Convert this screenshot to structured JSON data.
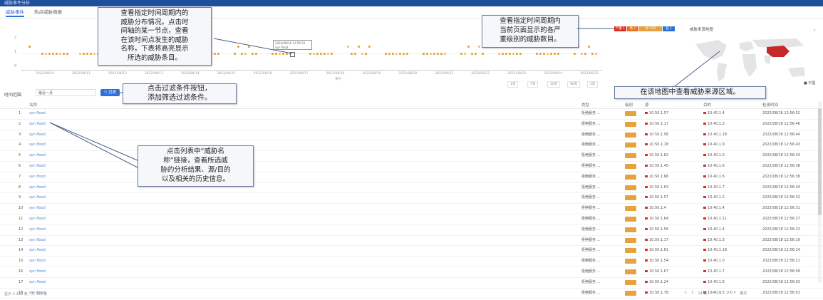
{
  "window": {
    "title": "威胁事件分析"
  },
  "tabs": [
    {
      "label": "威胁事件"
    },
    {
      "label": "热点威胁情报"
    }
  ],
  "timeline": {
    "y_ticks": [
      "2",
      "1",
      "0"
    ],
    "x_labels": [
      "2022/08/10",
      "2022/08/11",
      "2022/08/12",
      "2022/08/13",
      "2022/08/14",
      "2022/08/15",
      "2022/08/16",
      "2022/08/17",
      "2022/08/18",
      "2022/08/19",
      "2022/08/20",
      "2022/08/21",
      "2022/08/22",
      "2022/08/23",
      "2022/08/24",
      "2022/08/25"
    ],
    "tooltip_line1": "2022/08/18 12:56:52",
    "tooltip_line2": "syn flood",
    "footer": "事件",
    "controls": [
      "1天",
      "7天",
      "30天",
      "90天",
      "1年"
    ]
  },
  "severity_badges": [
    {
      "label": "严重 1",
      "color": "#d93025"
    },
    {
      "label": "高 1",
      "color": "#e8711a"
    },
    {
      "label": "中 120",
      "color": "#e6a23c"
    },
    {
      "label": "低 1",
      "color": "#2f6fd8"
    }
  ],
  "map": {
    "title": "威胁来源地图",
    "legend": "■ 中国"
  },
  "filter": {
    "label": "时间范围",
    "select_value": "最近一月",
    "button": "▽ 过滤"
  },
  "table": {
    "headers": {
      "name": "名称",
      "type": "类型",
      "severity": "级别",
      "src": "源",
      "dst": "目的",
      "time": "检测时间"
    },
    "rows": [
      {
        "idx": "1",
        "name": "syn flood",
        "type": "拒绝服务 ...",
        "src": "10.50.1.57",
        "dst": "10.40.1.4",
        "time": "2022/08/18 12:56:52"
      },
      {
        "idx": "2",
        "name": "syn flood",
        "type": "拒绝服务 ...",
        "src": "10.50.1.17",
        "dst": "10.40.1.3",
        "time": "2022/08/18 12:56:46"
      },
      {
        "idx": "3",
        "name": "syn flood",
        "type": "拒绝服务 ...",
        "src": "10.50.1.58",
        "dst": "10.40.1.18",
        "time": "2022/08/18 12:56:44"
      },
      {
        "idx": "4",
        "name": "syn flood",
        "type": "拒绝服务 ...",
        "src": "10.50.1.18",
        "dst": "10.40.1.9",
        "time": "2022/08/18 12:56:43"
      },
      {
        "idx": "5",
        "name": "syn flood",
        "type": "拒绝服务 ...",
        "src": "10.50.1.62",
        "dst": "10.40.1.0",
        "time": "2022/08/18 12:56:43"
      },
      {
        "idx": "6",
        "name": "syn flood",
        "type": "拒绝服务 ...",
        "src": "10.50.1.45",
        "dst": "10.40.1.6",
        "time": "2022/08/18 12:56:38"
      },
      {
        "idx": "7",
        "name": "syn flood",
        "type": "拒绝服务 ...",
        "src": "10.50.1.66",
        "dst": "10.40.1.6",
        "time": "2022/08/18 12:56:38"
      },
      {
        "idx": "8",
        "name": "syn flood",
        "type": "拒绝服务 ...",
        "src": "10.50.1.63",
        "dst": "10.40.1.7",
        "time": "2022/08/18 12:56:34"
      },
      {
        "idx": "9",
        "name": "syn flood",
        "type": "拒绝服务 ...",
        "src": "10.50.1.57",
        "dst": "10.40.1.2",
        "time": "2022/08/18 12:56:32"
      },
      {
        "idx": "10",
        "name": "syn flood",
        "type": "拒绝服务 ...",
        "src": "10.50.1.4",
        "dst": "10.40.1.4",
        "time": "2022/08/18 12:56:31"
      },
      {
        "idx": "11",
        "name": "syn flood",
        "type": "拒绝服务 ...",
        "src": "10.50.1.64",
        "dst": "10.40.1.11",
        "time": "2022/08/18 12:56:27"
      },
      {
        "idx": "12",
        "name": "syn flood",
        "type": "拒绝服务 ...",
        "src": "10.50.1.56",
        "dst": "10.40.1.4",
        "time": "2022/08/18 12:56:23"
      },
      {
        "idx": "13",
        "name": "syn flood",
        "type": "拒绝服务 ...",
        "src": "10.50.1.17",
        "dst": "10.40.1.3",
        "time": "2022/08/18 12:56:19"
      },
      {
        "idx": "14",
        "name": "syn flood",
        "type": "拒绝服务 ...",
        "src": "10.50.1.61",
        "dst": "10.40.1.18",
        "time": "2022/08/18 12:56:14"
      },
      {
        "idx": "15",
        "name": "syn flood",
        "type": "拒绝服务 ...",
        "src": "10.50.1.54",
        "dst": "10.40.1.0",
        "time": "2022/08/18 12:56:11"
      },
      {
        "idx": "16",
        "name": "syn flood",
        "type": "拒绝服务 ...",
        "src": "10.50.1.67",
        "dst": "10.40.1.7",
        "time": "2022/08/18 12:56:09"
      },
      {
        "idx": "17",
        "name": "syn flood",
        "type": "拒绝服务 ...",
        "src": "10.50.1.24",
        "dst": "10.40.1.6",
        "time": "2022/08/18 12:56:03"
      },
      {
        "idx": "18",
        "name": "syn flood",
        "type": "拒绝服务 ...",
        "src": "10.50.1.78",
        "dst": "10.40.1.5",
        "time": "2022/08/18 12:56:03"
      }
    ]
  },
  "footer": {
    "summary": "显示 1-100 条，共 350 条",
    "pager": [
      "<",
      "1",
      "14 页",
      ">",
      "⟳",
      "100 ▾",
      "确定"
    ]
  },
  "callouts": {
    "timeline": [
      "查看指定时间周期内的",
      "威胁分布情况。点击时",
      "间轴的某一节点，查看",
      "在该时间点发生的威胁",
      "名称，下表将高亮显示",
      "所选的威胁条目。"
    ],
    "severity": [
      "查看指定时间周期内",
      "当前页面显示的各严",
      "重级别的威胁数目。"
    ],
    "map": [
      "在该地图中查看威胁来源区域。"
    ],
    "filter": [
      "点击过滤条件按钮，",
      "添加筛选过滤条件。"
    ],
    "name": [
      "点击列表中“威胁名",
      "称”链接，查看所选威",
      "胁的分析结果、源/目的",
      "以及相关的历史信息。"
    ]
  }
}
